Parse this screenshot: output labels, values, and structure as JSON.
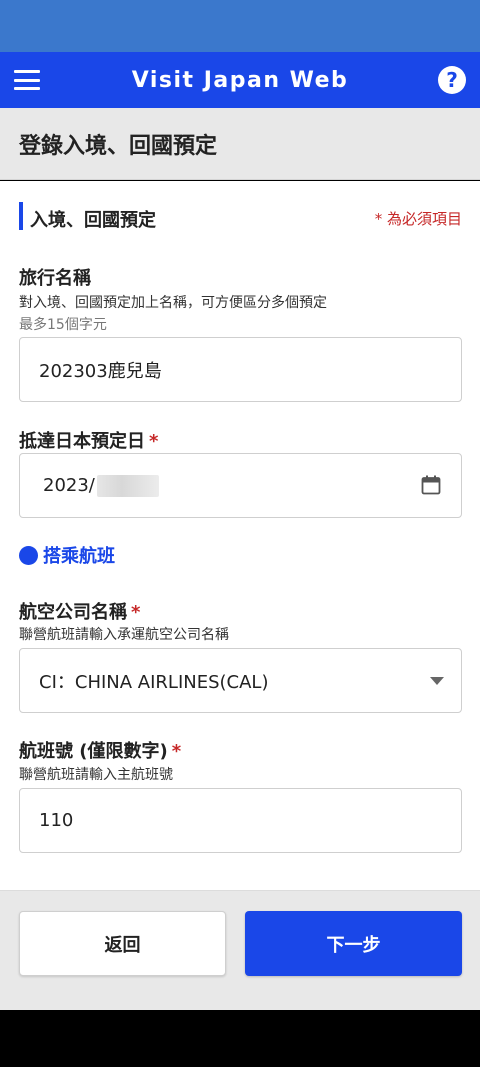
{
  "app_bar": {
    "title": "Visit Japan Web",
    "menu_icon": "hamburger-menu-icon",
    "help_icon": "question-circle-icon",
    "help_glyph": "?",
    "color": "#1a47e8"
  },
  "page": {
    "title": "登錄入境、回國預定"
  },
  "section": {
    "title": "入境、回國預定",
    "required_note": "* 為必須項目"
  },
  "trip_name": {
    "label": "旅行名稱",
    "helper": "對入境、回國預定加上名稱，可方便區分多個預定",
    "helper2": "最多15個字元",
    "value": "202303鹿兒島"
  },
  "arrival_date": {
    "label": "抵達日本預定日",
    "required_mark": "*",
    "value_visible": "2023/",
    "icon": "calendar-icon"
  },
  "flight_section": {
    "title": "搭乘航班"
  },
  "airline": {
    "label": "航空公司名稱",
    "required_mark": "*",
    "helper": "聯營航班請輸入承運航空公司名稱",
    "value": "CI：CHINA AIRLINES(CAL)",
    "icon": "dropdown-arrow-icon"
  },
  "flight_number": {
    "label": "航班號 (僅限數字)",
    "required_mark": "*",
    "helper": "聯營航班請輸入主航班號",
    "value": "110"
  },
  "footer": {
    "back_label": "返回",
    "next_label": "下一步"
  },
  "colors": {
    "primary": "#1a47e8",
    "required": "#c62828",
    "status_bar": "#3b78cc"
  }
}
